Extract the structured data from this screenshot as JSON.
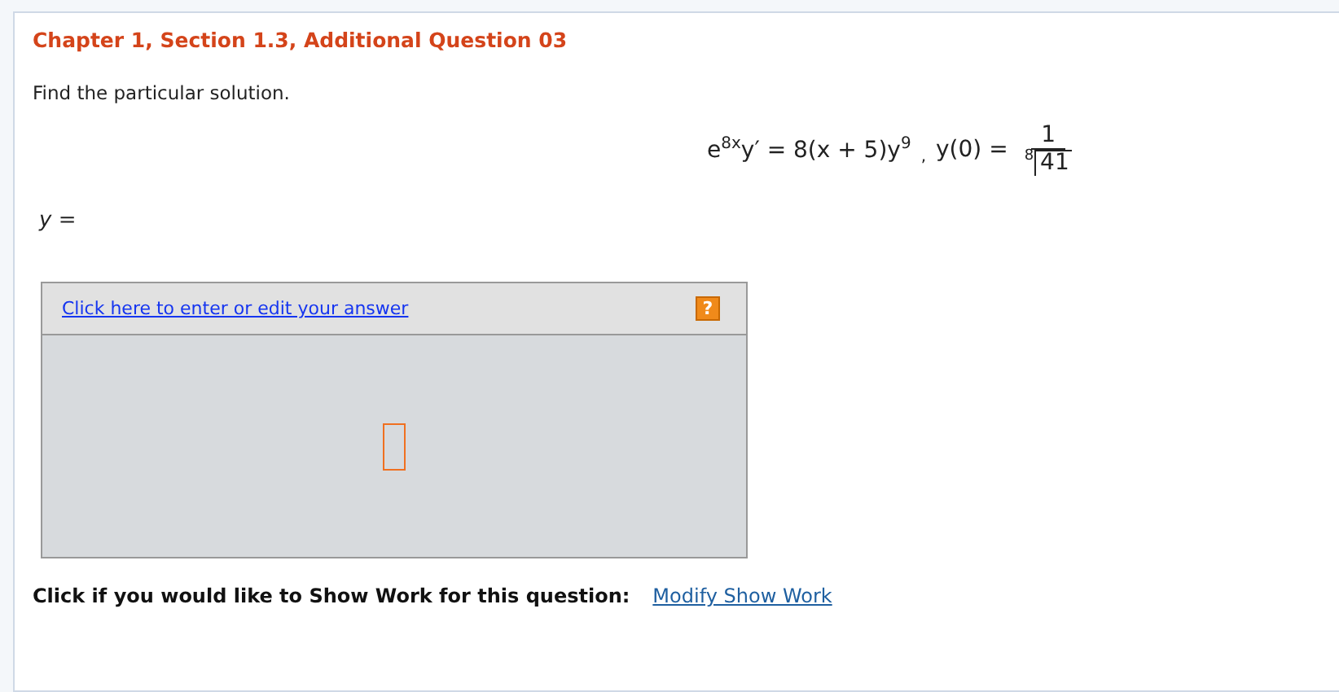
{
  "title": "Chapter 1, Section 1.3, Additional Question 03",
  "instruction": "Find the particular solution.",
  "equation": {
    "left": "e$^{8x}$y′ = 8(x + 5)y$^{9}$",
    "separator": ",",
    "condition": "y(0) =",
    "numerator": "1",
    "root_index": "8",
    "radicand": "41"
  },
  "answer_label": "y =",
  "answer_box": {
    "link": "Click here to enter or edit your answer",
    "help": "?"
  },
  "show_work": {
    "prompt": "Click if you would like to Show Work for this question:",
    "link": "Modify Show Work"
  }
}
